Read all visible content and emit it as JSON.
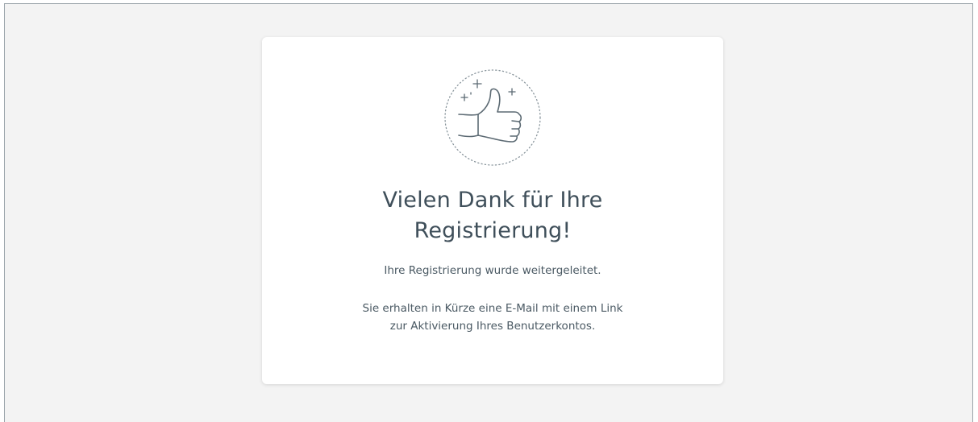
{
  "confirmation": {
    "icon": "thumbs-up-icon",
    "title_line1": "Vielen Dank für Ihre",
    "title_line2": "Registrierung!",
    "subtitle": "Ihre Registrierung wurde weitergeleitet.",
    "body_line1": "Sie erhalten in Kürze eine E-Mail mit einem Link",
    "body_line2": "zur Aktivierung Ihres Benutzerkontos."
  },
  "colors": {
    "page_background": "#f3f3f3",
    "card_background": "#ffffff",
    "text": "#3f4f5a",
    "icon_stroke": "#5c6a73"
  }
}
